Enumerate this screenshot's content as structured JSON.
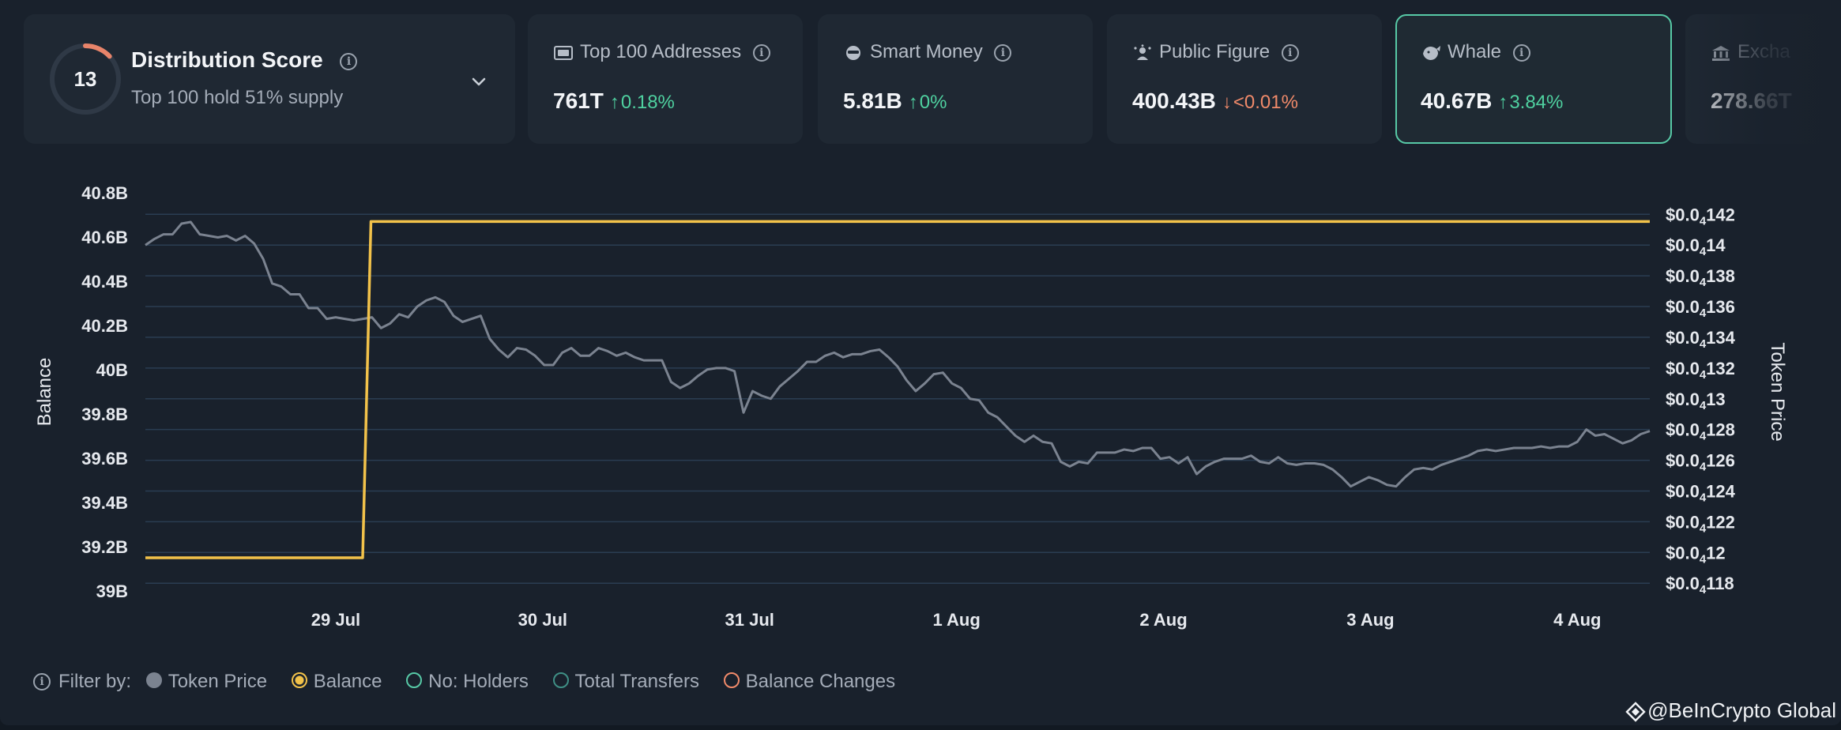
{
  "colors": {
    "balance": "#f2c24a",
    "token_price": "#7b8390",
    "grid": "#2a3d52",
    "up": "#4fd1a0",
    "down": "#f08a6a",
    "active_border": "#57c9a6"
  },
  "score_card": {
    "score": "13",
    "title": "Distribution Score",
    "subtitle": "Top 100 hold 51% supply",
    "score_fraction": 0.13
  },
  "stats": [
    {
      "icon": "addresses-icon",
      "label": "Top 100 Addresses",
      "value": "761T",
      "change": "0.18%",
      "dir": "up"
    },
    {
      "icon": "smart-money-icon",
      "label": "Smart Money",
      "value": "5.81B",
      "change": "0%",
      "dir": "up"
    },
    {
      "icon": "public-figure-icon",
      "label": "Public Figure",
      "value": "400.43B",
      "change": "<0.01%",
      "dir": "down"
    },
    {
      "icon": "whale-icon",
      "label": "Whale",
      "value": "40.67B",
      "change": "3.84%",
      "dir": "up"
    },
    {
      "icon": "exchange-icon",
      "label": "Excha",
      "value": "278.66T",
      "change": "",
      "dir": "up"
    }
  ],
  "filters": {
    "label": "Filter by:",
    "items": [
      {
        "name": "Token Price",
        "style": "filled",
        "color": "#7b8390"
      },
      {
        "name": "Balance",
        "style": "selected",
        "color": "#f2c24a"
      },
      {
        "name": "No: Holders",
        "style": "outline",
        "color": "#57c9a6"
      },
      {
        "name": "Total Transfers",
        "style": "outline",
        "color": "#3f8f85"
      },
      {
        "name": "Balance Changes",
        "style": "outline",
        "color": "#f08a6a"
      }
    ]
  },
  "watermark": "@BeInCrypto Global",
  "chart_data": {
    "type": "line",
    "ylabel": "Balance",
    "y2label": "Token Price",
    "x_ticks": [
      "29 Jul",
      "30 Jul",
      "31 Jul",
      "1 Aug",
      "2 Aug",
      "3 Aug",
      "4 Aug"
    ],
    "x_range_days": [
      -0.92,
      6.35
    ],
    "ylim": [
      39.0,
      40.8
    ],
    "y_ticks": [
      "40.8B",
      "40.6B",
      "40.4B",
      "40.2B",
      "40B",
      "39.8B",
      "39.6B",
      "39.4B",
      "39.2B",
      "39B"
    ],
    "y2_ticks": [
      {
        "base": "$0.0",
        "sub": "4",
        "tail": "142",
        "v": 0.0142
      },
      {
        "base": "$0.0",
        "sub": "4",
        "tail": "14",
        "v": 0.014
      },
      {
        "base": "$0.0",
        "sub": "4",
        "tail": "138",
        "v": 0.0138
      },
      {
        "base": "$0.0",
        "sub": "4",
        "tail": "136",
        "v": 0.0136
      },
      {
        "base": "$0.0",
        "sub": "4",
        "tail": "134",
        "v": 0.0134
      },
      {
        "base": "$0.0",
        "sub": "4",
        "tail": "132",
        "v": 0.0132
      },
      {
        "base": "$0.0",
        "sub": "4",
        "tail": "13",
        "v": 0.013
      },
      {
        "base": "$0.0",
        "sub": "4",
        "tail": "128",
        "v": 0.0128
      },
      {
        "base": "$0.0",
        "sub": "4",
        "tail": "126",
        "v": 0.0126
      },
      {
        "base": "$0.0",
        "sub": "4",
        "tail": "124",
        "v": 0.0124
      },
      {
        "base": "$0.0",
        "sub": "4",
        "tail": "122",
        "v": 0.0122
      },
      {
        "base": "$0.0",
        "sub": "4",
        "tail": "12",
        "v": 0.012
      },
      {
        "base": "$0.0",
        "sub": "4",
        "tail": "118",
        "v": 0.0118
      }
    ],
    "y2lim": [
      0.01176,
      0.01433
    ],
    "grid": true,
    "series": [
      {
        "name": "Balance",
        "axis": "left",
        "points": [
          [
            -0.92,
            39.15
          ],
          [
            0.13,
            39.15
          ],
          [
            0.17,
            40.67
          ],
          [
            6.35,
            40.67
          ]
        ]
      },
      {
        "name": "Token Price",
        "axis": "right",
        "values": [
          0.014,
          0.01404,
          0.01407,
          0.01407,
          0.01414,
          0.01415,
          0.01407,
          0.01406,
          0.01405,
          0.01406,
          0.01403,
          0.01406,
          0.01401,
          0.01391,
          0.01375,
          0.01373,
          0.01368,
          0.01368,
          0.01359,
          0.01359,
          0.01352,
          0.01353,
          0.01352,
          0.01351,
          0.01352,
          0.01353,
          0.01346,
          0.01349,
          0.01355,
          0.01353,
          0.0136,
          0.01364,
          0.01366,
          0.01363,
          0.01354,
          0.0135,
          0.01352,
          0.01354,
          0.01339,
          0.01332,
          0.01327,
          0.01333,
          0.01332,
          0.01328,
          0.01322,
          0.01322,
          0.0133,
          0.01333,
          0.01328,
          0.01328,
          0.01333,
          0.01331,
          0.01328,
          0.0133,
          0.01327,
          0.01325,
          0.01325,
          0.01325,
          0.01311,
          0.01307,
          0.0131,
          0.01315,
          0.01319,
          0.0132,
          0.0132,
          0.01318,
          0.01291,
          0.01305,
          0.01302,
          0.013,
          0.01308,
          0.01313,
          0.01318,
          0.01324,
          0.01324,
          0.01328,
          0.0133,
          0.01327,
          0.01329,
          0.01329,
          0.01331,
          0.01332,
          0.01327,
          0.01321,
          0.01312,
          0.01305,
          0.0131,
          0.01316,
          0.01317,
          0.0131,
          0.01307,
          0.013,
          0.01299,
          0.01291,
          0.01288,
          0.01282,
          0.01276,
          0.01272,
          0.01276,
          0.01272,
          0.01271,
          0.01259,
          0.01256,
          0.01259,
          0.01258,
          0.01265,
          0.01265,
          0.01265,
          0.01267,
          0.01266,
          0.01268,
          0.01268,
          0.01261,
          0.01262,
          0.01258,
          0.01262,
          0.01251,
          0.01256,
          0.01259,
          0.01261,
          0.01261,
          0.01261,
          0.01263,
          0.01259,
          0.01258,
          0.01262,
          0.01258,
          0.01257,
          0.01258,
          0.01258,
          0.01257,
          0.01254,
          0.01249,
          0.01243,
          0.01246,
          0.01249,
          0.01247,
          0.01244,
          0.01243,
          0.01249,
          0.01254,
          0.01255,
          0.01254,
          0.01257,
          0.01259,
          0.01261,
          0.01263,
          0.01266,
          0.01267,
          0.01266,
          0.01267,
          0.01268,
          0.01268,
          0.01268,
          0.01269,
          0.01268,
          0.01269,
          0.01269,
          0.01272,
          0.0128,
          0.01276,
          0.01277,
          0.01274,
          0.01271,
          0.01273,
          0.01277,
          0.01279
        ]
      }
    ]
  }
}
